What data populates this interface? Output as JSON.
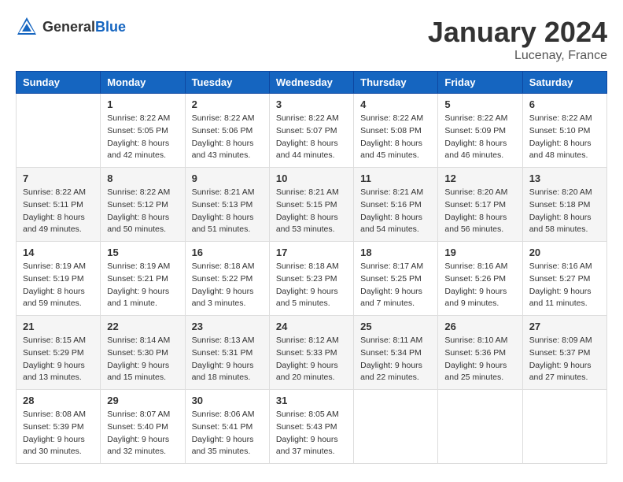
{
  "header": {
    "logo_general": "General",
    "logo_blue": "Blue",
    "month": "January 2024",
    "location": "Lucenay, France"
  },
  "days_of_week": [
    "Sunday",
    "Monday",
    "Tuesday",
    "Wednesday",
    "Thursday",
    "Friday",
    "Saturday"
  ],
  "weeks": [
    [
      {
        "day": "",
        "sunrise": "",
        "sunset": "",
        "daylight": ""
      },
      {
        "day": "1",
        "sunrise": "Sunrise: 8:22 AM",
        "sunset": "Sunset: 5:05 PM",
        "daylight": "Daylight: 8 hours and 42 minutes."
      },
      {
        "day": "2",
        "sunrise": "Sunrise: 8:22 AM",
        "sunset": "Sunset: 5:06 PM",
        "daylight": "Daylight: 8 hours and 43 minutes."
      },
      {
        "day": "3",
        "sunrise": "Sunrise: 8:22 AM",
        "sunset": "Sunset: 5:07 PM",
        "daylight": "Daylight: 8 hours and 44 minutes."
      },
      {
        "day": "4",
        "sunrise": "Sunrise: 8:22 AM",
        "sunset": "Sunset: 5:08 PM",
        "daylight": "Daylight: 8 hours and 45 minutes."
      },
      {
        "day": "5",
        "sunrise": "Sunrise: 8:22 AM",
        "sunset": "Sunset: 5:09 PM",
        "daylight": "Daylight: 8 hours and 46 minutes."
      },
      {
        "day": "6",
        "sunrise": "Sunrise: 8:22 AM",
        "sunset": "Sunset: 5:10 PM",
        "daylight": "Daylight: 8 hours and 48 minutes."
      }
    ],
    [
      {
        "day": "7",
        "sunrise": "Sunrise: 8:22 AM",
        "sunset": "Sunset: 5:11 PM",
        "daylight": "Daylight: 8 hours and 49 minutes."
      },
      {
        "day": "8",
        "sunrise": "Sunrise: 8:22 AM",
        "sunset": "Sunset: 5:12 PM",
        "daylight": "Daylight: 8 hours and 50 minutes."
      },
      {
        "day": "9",
        "sunrise": "Sunrise: 8:21 AM",
        "sunset": "Sunset: 5:13 PM",
        "daylight": "Daylight: 8 hours and 51 minutes."
      },
      {
        "day": "10",
        "sunrise": "Sunrise: 8:21 AM",
        "sunset": "Sunset: 5:15 PM",
        "daylight": "Daylight: 8 hours and 53 minutes."
      },
      {
        "day": "11",
        "sunrise": "Sunrise: 8:21 AM",
        "sunset": "Sunset: 5:16 PM",
        "daylight": "Daylight: 8 hours and 54 minutes."
      },
      {
        "day": "12",
        "sunrise": "Sunrise: 8:20 AM",
        "sunset": "Sunset: 5:17 PM",
        "daylight": "Daylight: 8 hours and 56 minutes."
      },
      {
        "day": "13",
        "sunrise": "Sunrise: 8:20 AM",
        "sunset": "Sunset: 5:18 PM",
        "daylight": "Daylight: 8 hours and 58 minutes."
      }
    ],
    [
      {
        "day": "14",
        "sunrise": "Sunrise: 8:19 AM",
        "sunset": "Sunset: 5:19 PM",
        "daylight": "Daylight: 8 hours and 59 minutes."
      },
      {
        "day": "15",
        "sunrise": "Sunrise: 8:19 AM",
        "sunset": "Sunset: 5:21 PM",
        "daylight": "Daylight: 9 hours and 1 minute."
      },
      {
        "day": "16",
        "sunrise": "Sunrise: 8:18 AM",
        "sunset": "Sunset: 5:22 PM",
        "daylight": "Daylight: 9 hours and 3 minutes."
      },
      {
        "day": "17",
        "sunrise": "Sunrise: 8:18 AM",
        "sunset": "Sunset: 5:23 PM",
        "daylight": "Daylight: 9 hours and 5 minutes."
      },
      {
        "day": "18",
        "sunrise": "Sunrise: 8:17 AM",
        "sunset": "Sunset: 5:25 PM",
        "daylight": "Daylight: 9 hours and 7 minutes."
      },
      {
        "day": "19",
        "sunrise": "Sunrise: 8:16 AM",
        "sunset": "Sunset: 5:26 PM",
        "daylight": "Daylight: 9 hours and 9 minutes."
      },
      {
        "day": "20",
        "sunrise": "Sunrise: 8:16 AM",
        "sunset": "Sunset: 5:27 PM",
        "daylight": "Daylight: 9 hours and 11 minutes."
      }
    ],
    [
      {
        "day": "21",
        "sunrise": "Sunrise: 8:15 AM",
        "sunset": "Sunset: 5:29 PM",
        "daylight": "Daylight: 9 hours and 13 minutes."
      },
      {
        "day": "22",
        "sunrise": "Sunrise: 8:14 AM",
        "sunset": "Sunset: 5:30 PM",
        "daylight": "Daylight: 9 hours and 15 minutes."
      },
      {
        "day": "23",
        "sunrise": "Sunrise: 8:13 AM",
        "sunset": "Sunset: 5:31 PM",
        "daylight": "Daylight: 9 hours and 18 minutes."
      },
      {
        "day": "24",
        "sunrise": "Sunrise: 8:12 AM",
        "sunset": "Sunset: 5:33 PM",
        "daylight": "Daylight: 9 hours and 20 minutes."
      },
      {
        "day": "25",
        "sunrise": "Sunrise: 8:11 AM",
        "sunset": "Sunset: 5:34 PM",
        "daylight": "Daylight: 9 hours and 22 minutes."
      },
      {
        "day": "26",
        "sunrise": "Sunrise: 8:10 AM",
        "sunset": "Sunset: 5:36 PM",
        "daylight": "Daylight: 9 hours and 25 minutes."
      },
      {
        "day": "27",
        "sunrise": "Sunrise: 8:09 AM",
        "sunset": "Sunset: 5:37 PM",
        "daylight": "Daylight: 9 hours and 27 minutes."
      }
    ],
    [
      {
        "day": "28",
        "sunrise": "Sunrise: 8:08 AM",
        "sunset": "Sunset: 5:39 PM",
        "daylight": "Daylight: 9 hours and 30 minutes."
      },
      {
        "day": "29",
        "sunrise": "Sunrise: 8:07 AM",
        "sunset": "Sunset: 5:40 PM",
        "daylight": "Daylight: 9 hours and 32 minutes."
      },
      {
        "day": "30",
        "sunrise": "Sunrise: 8:06 AM",
        "sunset": "Sunset: 5:41 PM",
        "daylight": "Daylight: 9 hours and 35 minutes."
      },
      {
        "day": "31",
        "sunrise": "Sunrise: 8:05 AM",
        "sunset": "Sunset: 5:43 PM",
        "daylight": "Daylight: 9 hours and 37 minutes."
      },
      {
        "day": "",
        "sunrise": "",
        "sunset": "",
        "daylight": ""
      },
      {
        "day": "",
        "sunrise": "",
        "sunset": "",
        "daylight": ""
      },
      {
        "day": "",
        "sunrise": "",
        "sunset": "",
        "daylight": ""
      }
    ]
  ]
}
